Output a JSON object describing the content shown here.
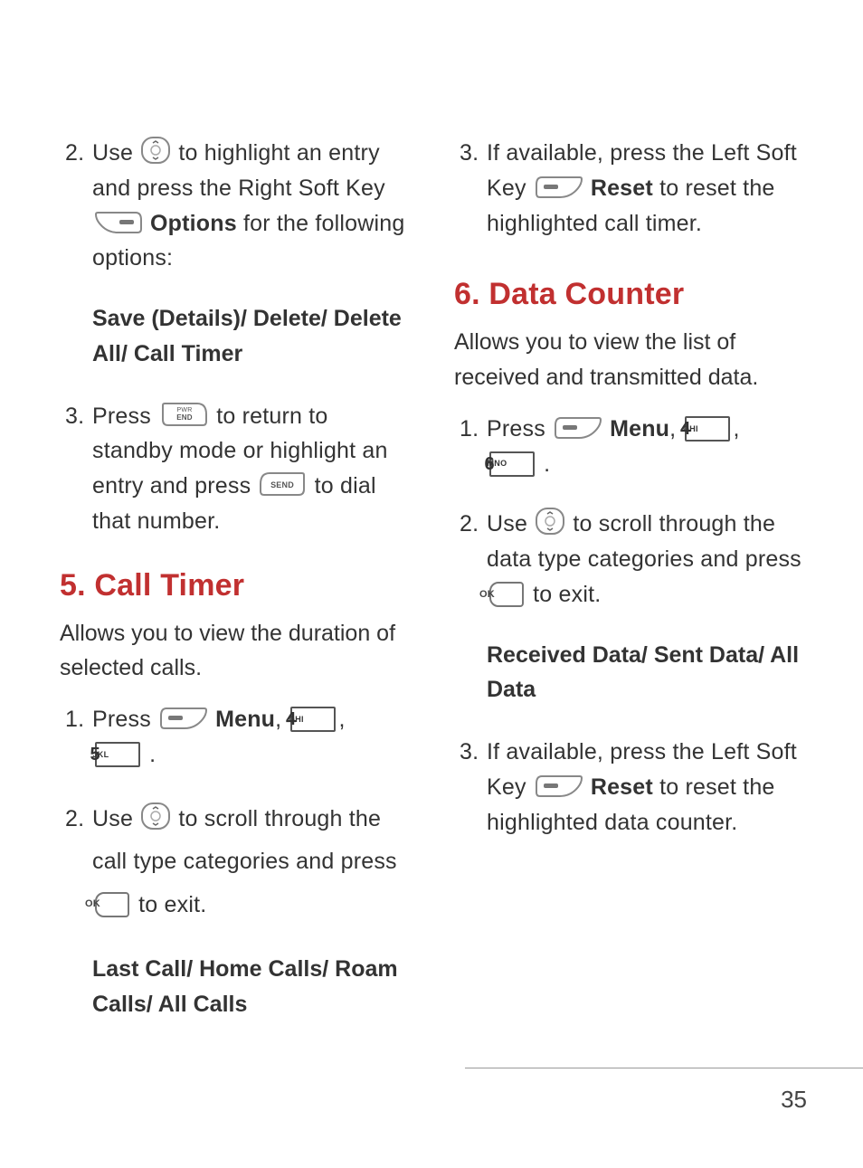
{
  "page_number": "35",
  "icons": {
    "nav": "nav-key-icon",
    "right_soft": "right-soft-key-icon",
    "left_soft": "left-soft-key-icon",
    "end": "end-key-icon",
    "send": "send-key-icon",
    "ok": "ok-key-icon"
  },
  "keys": {
    "end_label_top": "PWR",
    "end_label_bot": "END",
    "send_label": "SEND",
    "ok_label": "OK",
    "numpad": {
      "4": {
        "digit": "4",
        "letters": "GHI"
      },
      "5": {
        "digit": "5",
        "letters": "JKL"
      },
      "6": {
        "digit": "6",
        "letters": "MNO"
      }
    }
  },
  "left": {
    "s2": {
      "num": "2.",
      "t1": "Use ",
      "t2": " to highlight an entry and press the Right Soft Key ",
      "options": "Options",
      "t3": " for the following options:"
    },
    "opts1": "Save (Details)/ Delete/ Delete All/ Call Timer",
    "s3": {
      "num": "3.",
      "t1": "Press ",
      "t2": " to return to standby mode or highlight an entry and press ",
      "t3": " to dial that number."
    },
    "call_timer": {
      "heading": "5. Call Timer",
      "desc": "Allows you to view the duration of selected calls.",
      "s1": {
        "num": "1.",
        "t1": "Press ",
        "menu": "Menu",
        "comma": ", ",
        "dot": " ."
      },
      "s2": {
        "num": "2.",
        "t1": "Use ",
        "t2": " to scroll through the call type categories and press ",
        "t3": " to exit."
      },
      "cats": "Last Call/ Home Calls/ Roam Calls/ All Calls"
    }
  },
  "right": {
    "s3": {
      "num": "3.",
      "t1": "If available, press the Left Soft Key ",
      "reset": "Reset",
      "t2": " to reset the highlighted call timer."
    },
    "data_counter": {
      "heading": "6. Data Counter",
      "desc": "Allows you to view the list of received and transmitted data.",
      "s1": {
        "num": "1.",
        "t1": "Press ",
        "menu": "Menu",
        "comma": ", ",
        "dot": " ."
      },
      "s2": {
        "num": "2.",
        "t1": "Use ",
        "t2": " to scroll through the data type categories and press ",
        "t3": " to exit."
      },
      "cats": "Received Data/ Sent Data/ All Data",
      "s3": {
        "num": "3.",
        "t1": "If available, press the Left Soft Key ",
        "reset": "Reset",
        "t2": " to reset the highlighted data counter."
      }
    }
  }
}
